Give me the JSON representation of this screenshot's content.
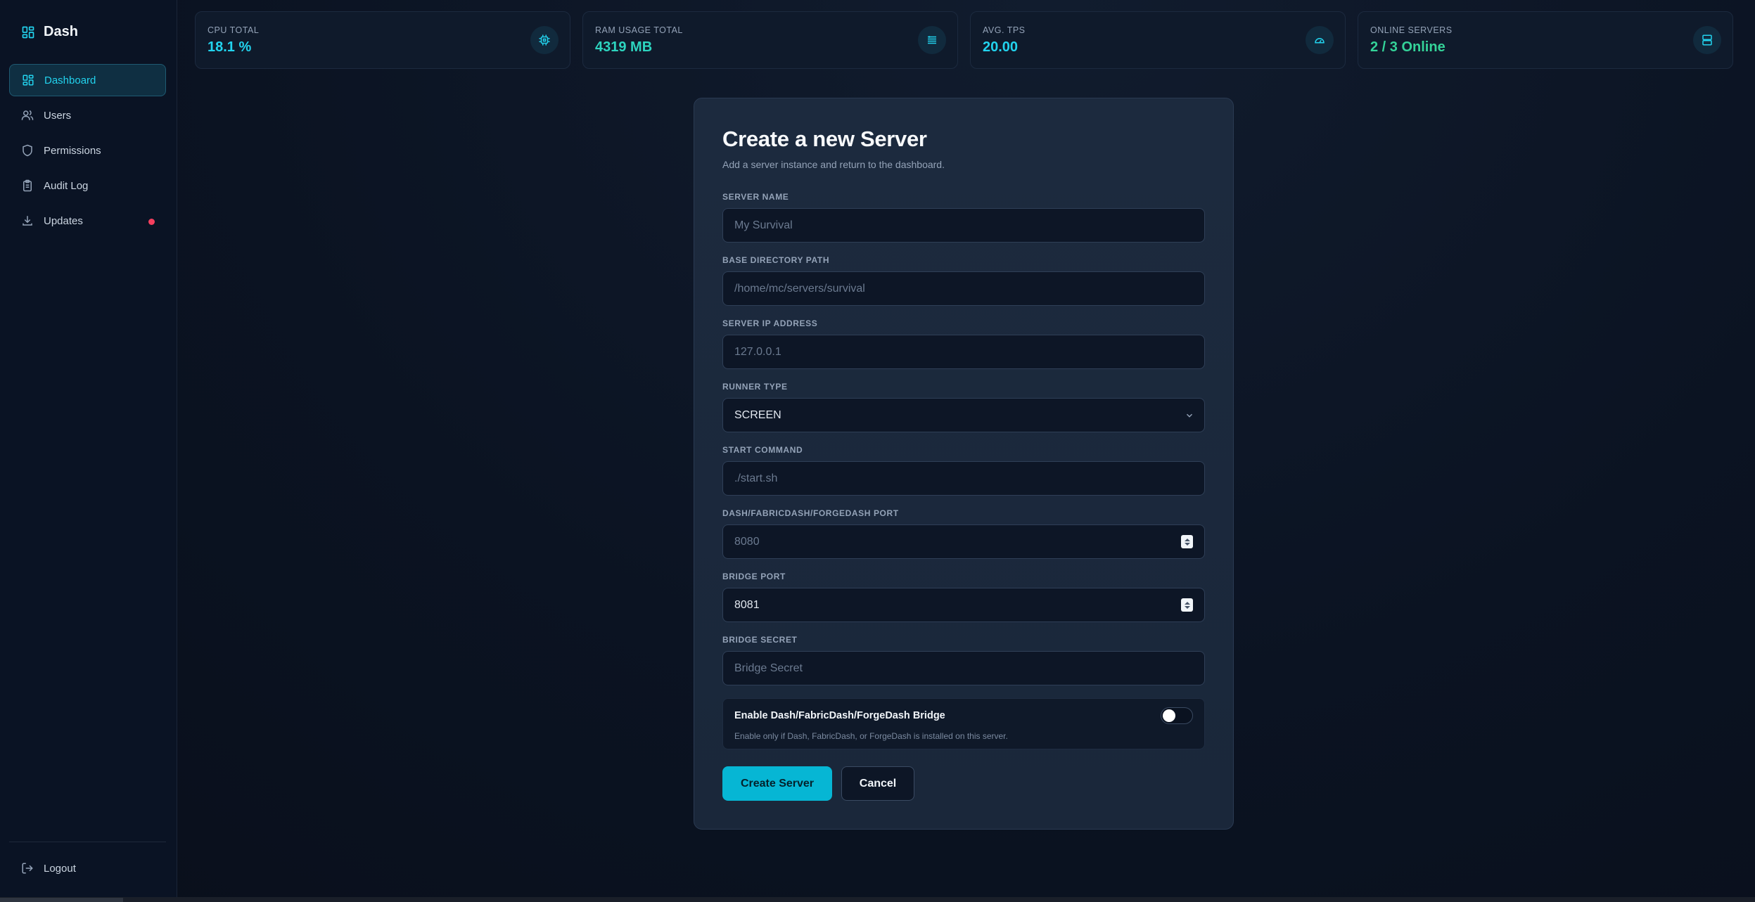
{
  "brand": {
    "name": "Dash"
  },
  "sidebar": {
    "items": [
      {
        "label": "Dashboard",
        "icon": "dashboard-grid-icon",
        "active": true
      },
      {
        "label": "Users",
        "icon": "users-icon"
      },
      {
        "label": "Permissions",
        "icon": "shield-icon"
      },
      {
        "label": "Audit Log",
        "icon": "clipboard-icon"
      },
      {
        "label": "Updates",
        "icon": "download-icon",
        "badge": "dot"
      }
    ],
    "logout_label": "Logout"
  },
  "stats": [
    {
      "label": "CPU TOTAL",
      "value": "18.1 %",
      "color": "#22d3ee",
      "icon": "cpu-icon"
    },
    {
      "label": "RAM USAGE TOTAL",
      "value": "4319 MB",
      "color": "#2dd4bf",
      "icon": "memory-icon"
    },
    {
      "label": "AVG. TPS",
      "value": "20.00",
      "color": "#22d3ee",
      "icon": "gauge-icon"
    },
    {
      "label": "ONLINE SERVERS",
      "value": "2 / 3 Online",
      "color": "#34d399",
      "icon": "server-icon"
    }
  ],
  "form": {
    "title": "Create a new Server",
    "subtitle": "Add a server instance and return to the dashboard.",
    "fields": {
      "server_name": {
        "label": "SERVER NAME",
        "placeholder": "My Survival",
        "value": ""
      },
      "base_dir": {
        "label": "BASE DIRECTORY PATH",
        "placeholder": "/home/mc/servers/survival",
        "value": ""
      },
      "server_ip": {
        "label": "SERVER IP ADDRESS",
        "placeholder": "127.0.0.1",
        "value": ""
      },
      "runner_type": {
        "label": "RUNNER TYPE",
        "value": "SCREEN"
      },
      "start_command": {
        "label": "START COMMAND",
        "placeholder": "./start.sh",
        "value": ""
      },
      "dash_port": {
        "label": "DASH/FABRICDASH/FORGEDASH PORT",
        "placeholder": "8080",
        "value": ""
      },
      "bridge_port": {
        "label": "BRIDGE PORT",
        "placeholder": "",
        "value": "8081"
      },
      "bridge_secret": {
        "label": "BRIDGE SECRET",
        "placeholder": "Bridge Secret",
        "value": ""
      }
    },
    "bridge_toggle": {
      "title": "Enable Dash/FabricDash/ForgeDash Bridge",
      "description": "Enable only if Dash, FabricDash, or ForgeDash is installed on this server.",
      "enabled": false
    },
    "submit_label": "Create Server",
    "cancel_label": "Cancel"
  },
  "colors": {
    "accent": "#06b6d4",
    "badge_red": "#f43f5e"
  }
}
